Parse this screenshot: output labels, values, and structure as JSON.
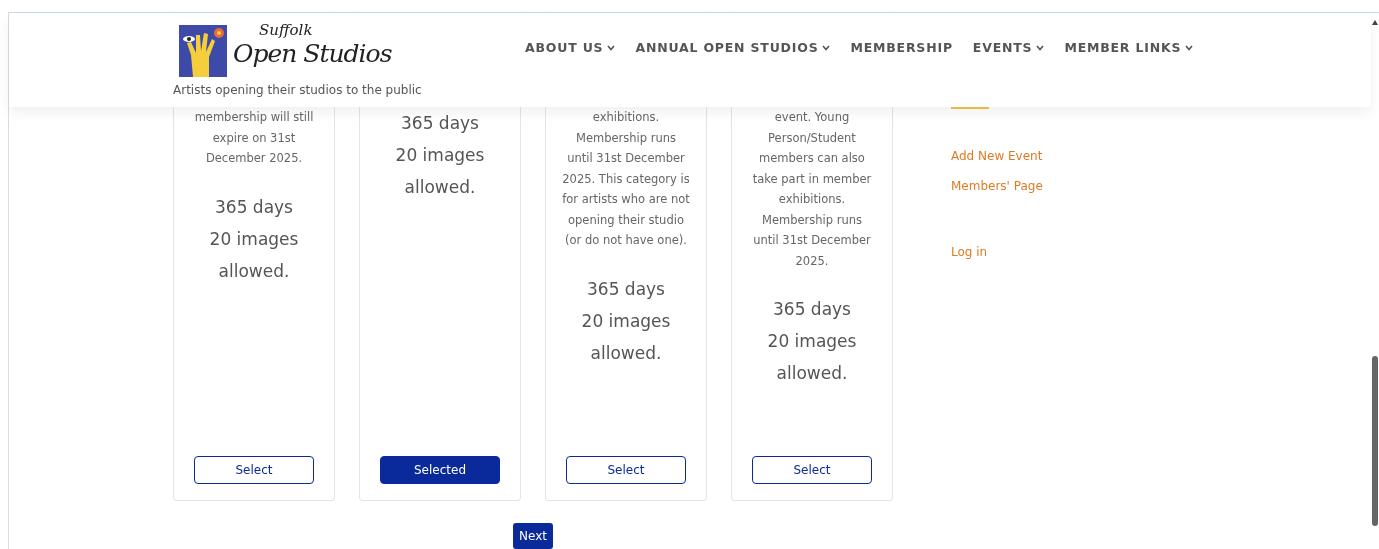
{
  "header": {
    "logo_words": [
      "Suffolk",
      "Open Studios"
    ],
    "tagline": "Artists opening their studios to the public",
    "nav": [
      {
        "label": "ABOUT US",
        "dropdown": true
      },
      {
        "label": "ANNUAL OPEN STUDIOS",
        "dropdown": true
      },
      {
        "label": "MEMBERSHIP",
        "dropdown": false
      },
      {
        "label": "EVENTS",
        "dropdown": true
      },
      {
        "label": "MEMBER LINKS",
        "dropdown": true
      }
    ]
  },
  "plans": [
    {
      "description": "membership will still expire on 31st December 2025.",
      "stats": [
        "365 days",
        "20 images",
        "allowed."
      ],
      "button": "Select",
      "selected": false
    },
    {
      "stats": [
        "365 days",
        "20 images",
        "allowed."
      ],
      "button": "Selected",
      "selected": true
    },
    {
      "description": "exhibitions. Membership runs until 31st December 2025. This category is for artists who are not opening their studio (or do not have one).",
      "stats": [
        "365 days",
        "20 images",
        "allowed."
      ],
      "button": "Select",
      "selected": false
    },
    {
      "description": "event. Young Person/Student members can also take part in member exhibitions. Membership runs until 31st December 2025.",
      "stats": [
        "365 days",
        "20 images",
        "allowed."
      ],
      "button": "Select",
      "selected": false
    }
  ],
  "next_button": "Next",
  "sidebar": {
    "links": [
      "Add New Event",
      "Members' Page"
    ],
    "account_links": [
      "Log in"
    ]
  }
}
